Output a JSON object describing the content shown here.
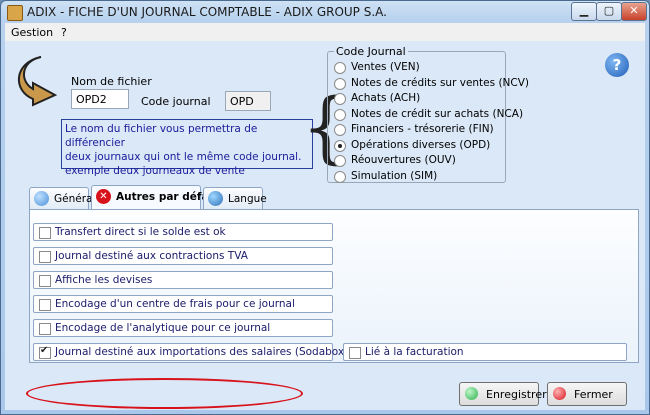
{
  "window": {
    "title": "ADIX - FICHE D'UN JOURNAL COMPTABLE - ADIX GROUP S.A."
  },
  "menu": {
    "items": [
      "Gestion",
      "?"
    ]
  },
  "form": {
    "nom_fichier_label": "Nom de fichier",
    "nom_fichier_value": "OPD2",
    "code_journal_label": "Code journal",
    "code_journal_value": "OPD",
    "note_lines": [
      "Le nom du fichier vous permettra de différencier",
      "deux journaux qui ont le même code journal.",
      "exemple deux journeaux de vente"
    ]
  },
  "code_journal_group": {
    "title": "Code Journal",
    "selected_index": 5,
    "options": [
      "Ventes (VEN)",
      "Notes de crédits sur ventes (NCV)",
      "Achats (ACH)",
      "Notes de crédit sur achats (NCA)",
      "Financiers - trésorerie (FIN)",
      "Opérations diverses (OPD)",
      "Réouvertures (OUV)",
      "Simulation (SIM)"
    ]
  },
  "tabs": [
    {
      "label": "Général",
      "icon": "globe-icon",
      "color": "#4a90d9"
    },
    {
      "label": "Autres par défaut",
      "icon": "cancel-icon",
      "color": "#d8121b"
    },
    {
      "label": "Langue",
      "icon": "earth-icon",
      "color": "#2d6fb8"
    }
  ],
  "active_tab": 1,
  "options": [
    {
      "label": "Transfert direct si le solde est ok",
      "checked": false
    },
    {
      "label": "Journal destiné aux contractions TVA",
      "checked": false
    },
    {
      "label": "Affiche les devises",
      "checked": false
    },
    {
      "label": "Encodage d'un centre de frais pour ce journal",
      "checked": false
    },
    {
      "label": "Encodage de l'analytique pour ce journal",
      "checked": false
    },
    {
      "label": "Journal destiné aux importations des salaires (Sodabox)",
      "checked": true
    }
  ],
  "option_right": {
    "label": "Lié à la facturation",
    "checked": false
  },
  "buttons": {
    "save": {
      "label": "Enregistrer",
      "color": "#2bb24c"
    },
    "close": {
      "label": "Fermer",
      "color": "#d8121b"
    }
  },
  "window_buttons": {
    "minimize": "▁",
    "maximize": "▢",
    "close": "✕"
  }
}
